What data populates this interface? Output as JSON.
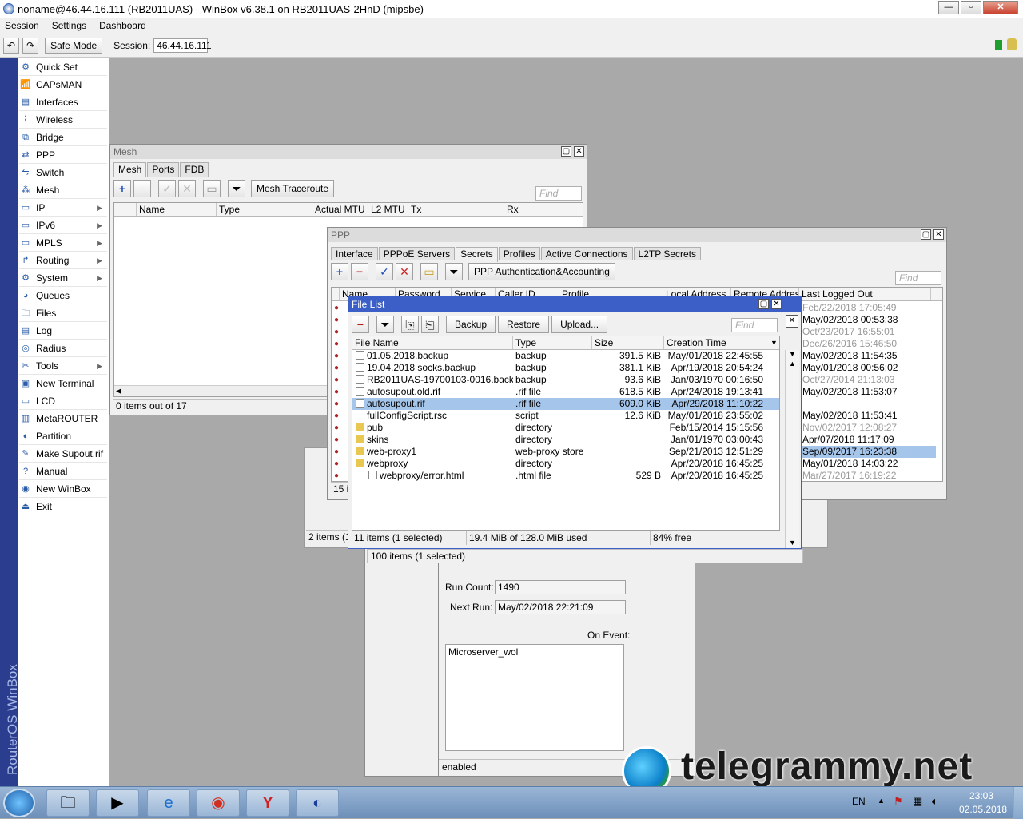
{
  "window_title": "noname@46.44.16.111 (RB2011UAS) - WinBox v6.38.1 on RB2011UAS-2HnD (mipsbe)",
  "menu": [
    "Session",
    "Settings",
    "Dashboard"
  ],
  "toolbar": {
    "safe_mode": "Safe Mode",
    "session_label": "Session:",
    "session_value": "46.44.16.111"
  },
  "sidebar": {
    "brand": "RouterOS WinBox",
    "items": [
      {
        "label": "Quick Set",
        "icon": "quick-set-icon"
      },
      {
        "label": "CAPsMAN",
        "icon": "capsman-icon"
      },
      {
        "label": "Interfaces",
        "icon": "interfaces-icon"
      },
      {
        "label": "Wireless",
        "icon": "wireless-icon"
      },
      {
        "label": "Bridge",
        "icon": "bridge-icon"
      },
      {
        "label": "PPP",
        "icon": "ppp-icon"
      },
      {
        "label": "Switch",
        "icon": "switch-icon"
      },
      {
        "label": "Mesh",
        "icon": "mesh-icon"
      },
      {
        "label": "IP",
        "icon": "ip-icon",
        "submenu": true
      },
      {
        "label": "IPv6",
        "icon": "ipv6-icon",
        "submenu": true
      },
      {
        "label": "MPLS",
        "icon": "mpls-icon",
        "submenu": true
      },
      {
        "label": "Routing",
        "icon": "routing-icon",
        "submenu": true
      },
      {
        "label": "System",
        "icon": "system-icon",
        "submenu": true
      },
      {
        "label": "Queues",
        "icon": "queues-icon"
      },
      {
        "label": "Files",
        "icon": "files-icon"
      },
      {
        "label": "Log",
        "icon": "log-icon"
      },
      {
        "label": "Radius",
        "icon": "radius-icon"
      },
      {
        "label": "Tools",
        "icon": "tools-icon",
        "submenu": true
      },
      {
        "label": "New Terminal",
        "icon": "terminal-icon"
      },
      {
        "label": "LCD",
        "icon": "lcd-icon"
      },
      {
        "label": "MetaROUTER",
        "icon": "metarouter-icon"
      },
      {
        "label": "Partition",
        "icon": "partition-icon"
      },
      {
        "label": "Make Supout.rif",
        "icon": "supout-icon"
      },
      {
        "label": "Manual",
        "icon": "manual-icon"
      },
      {
        "label": "New WinBox",
        "icon": "winbox-icon"
      },
      {
        "label": "Exit",
        "icon": "exit-icon"
      }
    ]
  },
  "mesh": {
    "title": "Mesh",
    "tabs": [
      "Mesh",
      "Ports",
      "FDB"
    ],
    "traceroute": "Mesh Traceroute",
    "find": "Find",
    "columns": [
      "Name",
      "Type",
      "Actual MTU",
      "L2 MTU",
      "Tx",
      "Rx"
    ],
    "status": "0 items out of 17"
  },
  "ppp": {
    "title": "PPP",
    "tabs": [
      "Interface",
      "PPPoE Servers",
      "Secrets",
      "Profiles",
      "Active Connections",
      "L2TP Secrets"
    ],
    "auth_button": "PPP Authentication&Accounting",
    "find": "Find",
    "columns": [
      "Name",
      "Password",
      "Service",
      "Caller ID",
      "Profile",
      "Local Address",
      "Remote Address",
      "Last Logged Out"
    ],
    "last_logged_out": [
      {
        "v": "Feb/22/2018 17:05:49",
        "dim": true
      },
      {
        "v": "May/02/2018 00:53:38",
        "dim": false
      },
      {
        "v": "Oct/23/2017 16:55:01",
        "dim": true
      },
      {
        "v": "Dec/26/2016 15:46:50",
        "dim": true
      },
      {
        "v": "May/02/2018 11:54:35",
        "dim": false
      },
      {
        "v": "May/01/2018 00:56:02",
        "dim": false
      },
      {
        "v": "Oct/27/2014 21:13:03",
        "dim": true
      },
      {
        "v": "May/02/2018 11:53:07",
        "dim": false
      },
      {
        "v": "",
        "dim": false
      },
      {
        "v": "May/02/2018 11:53:41",
        "dim": false
      },
      {
        "v": "Nov/02/2017 12:08:27",
        "dim": true
      },
      {
        "v": "Apr/07/2018 11:17:09",
        "dim": false
      },
      {
        "v": "Sep/09/2017 16:23:38",
        "dim": false,
        "sel": true
      },
      {
        "v": "May/01/2018 14:03:22",
        "dim": false
      },
      {
        "v": "Mar/27/2017 16:19:22",
        "dim": true
      }
    ],
    "status": "15 it"
  },
  "backwin": {
    "status": "2 items (1 s"
  },
  "filelist": {
    "title": "File List",
    "buttons": {
      "backup": "Backup",
      "restore": "Restore",
      "upload": "Upload..."
    },
    "find": "Find",
    "columns": [
      "File Name",
      "Type",
      "Size",
      "Creation Time"
    ],
    "rows": [
      {
        "name": "01.05.2018.backup",
        "type": "backup",
        "size": "391.5 KiB",
        "time": "May/01/2018 22:45:55",
        "kind": "file",
        "indent": false
      },
      {
        "name": "19.04.2018 socks.backup",
        "type": "backup",
        "size": "381.1 KiB",
        "time": "Apr/19/2018 20:54:24",
        "kind": "file",
        "indent": false
      },
      {
        "name": "RB2011UAS-19700103-0016.backup",
        "type": "backup",
        "size": "93.6 KiB",
        "time": "Jan/03/1970 00:16:50",
        "kind": "file",
        "indent": false
      },
      {
        "name": "autosupout.old.rif",
        "type": ".rif file",
        "size": "618.5 KiB",
        "time": "Apr/24/2018 19:13:41",
        "kind": "file",
        "indent": false
      },
      {
        "name": "autosupout.rif",
        "type": ".rif file",
        "size": "609.0 KiB",
        "time": "Apr/29/2018 11:10:22",
        "kind": "file",
        "indent": false,
        "selected": true
      },
      {
        "name": "fullConfigScript.rsc",
        "type": "script",
        "size": "12.6 KiB",
        "time": "May/01/2018 23:55:02",
        "kind": "file",
        "indent": false
      },
      {
        "name": "pub",
        "type": "directory",
        "size": "",
        "time": "Feb/15/2014 15:15:56",
        "kind": "folder",
        "indent": false
      },
      {
        "name": "skins",
        "type": "directory",
        "size": "",
        "time": "Jan/01/1970 03:00:43",
        "kind": "folder",
        "indent": false
      },
      {
        "name": "web-proxy1",
        "type": "web-proxy store",
        "size": "",
        "time": "Sep/21/2013 12:51:29",
        "kind": "folder",
        "indent": false
      },
      {
        "name": "webproxy",
        "type": "directory",
        "size": "",
        "time": "Apr/20/2018 16:45:25",
        "kind": "folder",
        "indent": false
      },
      {
        "name": "webproxy/error.html",
        "type": ".html file",
        "size": "529 B",
        "time": "Apr/20/2018 16:45:25",
        "kind": "file",
        "indent": true
      }
    ],
    "status": {
      "items": "11 items (1 selected)",
      "usage": "19.4 MiB of 128.0 MiB used",
      "free": "84% free"
    }
  },
  "scheduler": {
    "status_top": "100 items (1 selected)",
    "run_count_label": "Run Count:",
    "run_count": "1490",
    "next_run_label": "Next Run:",
    "next_run": "May/02/2018 22:21:09",
    "on_event_label": "On Event:",
    "on_event": "Microserver_wol",
    "state": "enabled"
  },
  "watermark": "telegrammy.net",
  "taskbar": {
    "lang": "EN",
    "time": "23:03",
    "date": "02.05.2018"
  }
}
